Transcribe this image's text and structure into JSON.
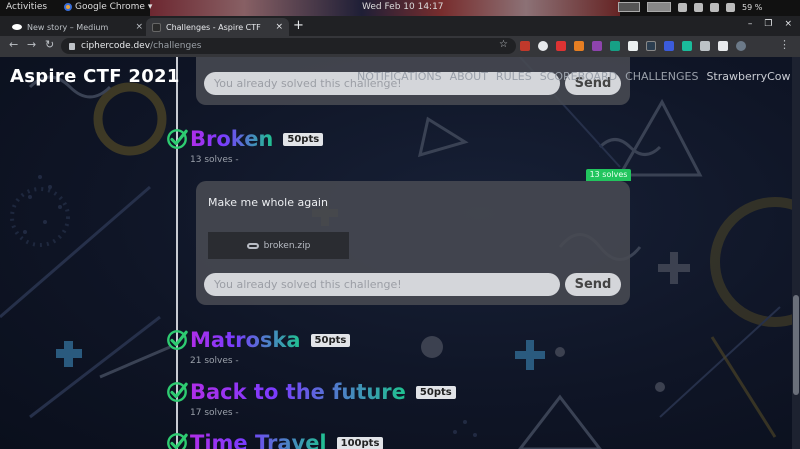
{
  "system_bar": {
    "activities": "Activities",
    "app_name": "Google Chrome",
    "app_menu_caret": "▾",
    "clock": "Wed Feb 10  14:17",
    "battery": "59 %"
  },
  "browser": {
    "tabs": [
      {
        "title": "New story – Medium",
        "close": "×",
        "active": false
      },
      {
        "title": "Challenges - Aspire CTF",
        "close": "×",
        "active": true
      }
    ],
    "new_tab": "+",
    "window_controls": [
      "–",
      "❐",
      "×"
    ],
    "nav": {
      "back": "←",
      "forward": "→",
      "reload": "↻"
    },
    "url_host": "ciphercode.dev",
    "url_path": "/challenges",
    "bookmark_star": "☆",
    "menu": "⋮"
  },
  "site": {
    "title": "Aspire CTF 2021",
    "nav": [
      "NOTIFICATIONS",
      "ABOUT",
      "RULES",
      "SCOREBOARD",
      "CHALLENGES"
    ],
    "user": "StrawberryCow",
    "user_caret": "▼"
  },
  "top_card": {
    "placeholder": "You already solved this challenge!",
    "send": "Send"
  },
  "challenges": [
    {
      "name": "Broken",
      "points": "50pts",
      "solves": "13 solves -"
    },
    {
      "name": "Matroska",
      "points": "50pts",
      "solves": "21 solves -"
    },
    {
      "name": "Back to the future",
      "points": "50pts",
      "solves": "17 solves -"
    },
    {
      "name": "Time Travel",
      "points": "100pts"
    }
  ],
  "expanded": {
    "solve_tag": "13 solves",
    "description": "Make me whole again",
    "file": "broken.zip",
    "placeholder": "You already solved this challenge!",
    "send": "Send"
  },
  "colors": {
    "accent_green": "#22c55e",
    "title_gradient_start": "#b02ee8",
    "title_gradient_end": "#1fc38f",
    "check_green": "#2ecc71"
  }
}
